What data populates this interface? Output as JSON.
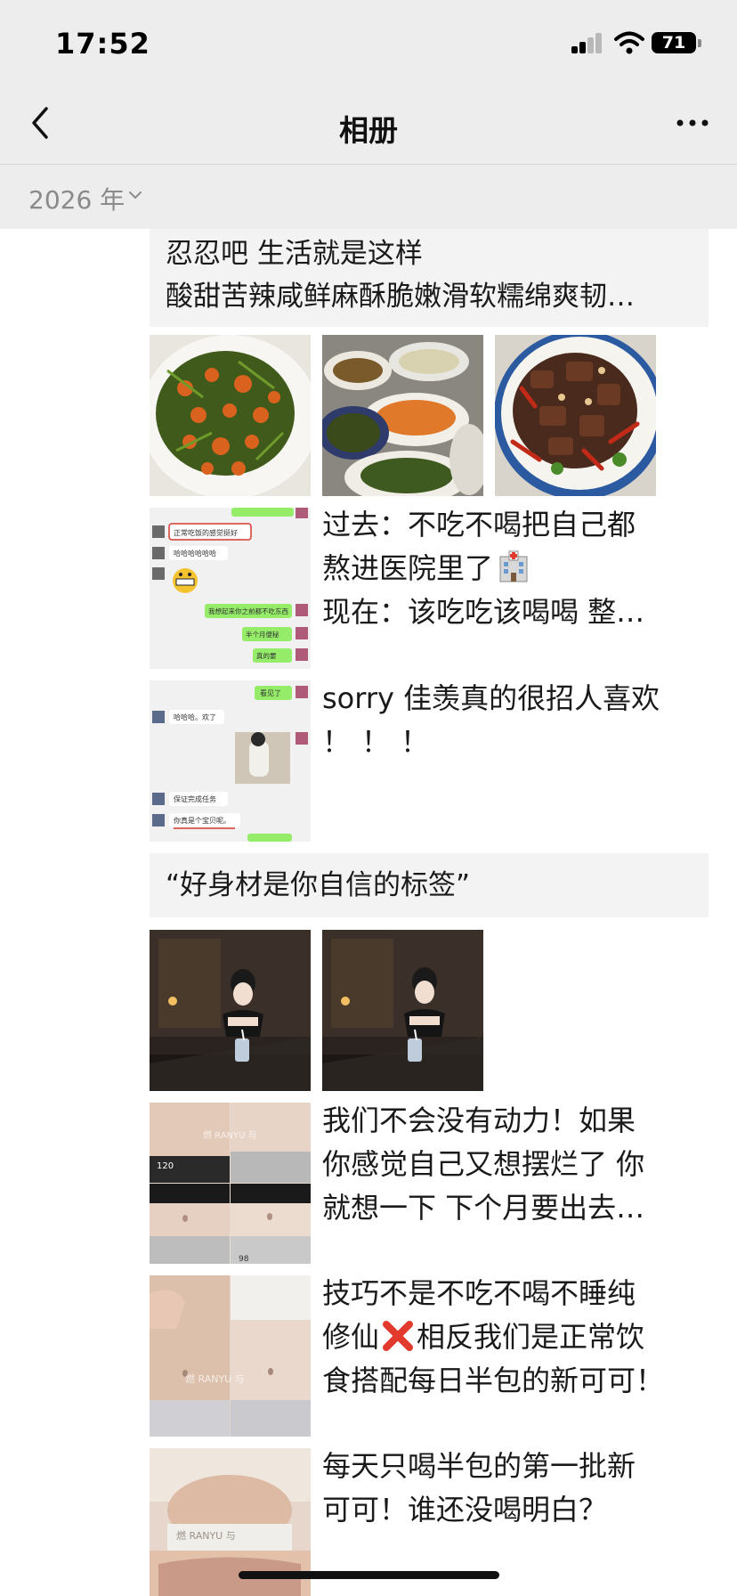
{
  "status": {
    "time": "17:52",
    "battery": "71"
  },
  "nav": {
    "title": "相册"
  },
  "year_filter": {
    "label": "2026 年"
  },
  "posts": [
    {
      "lines": [
        "忍忍吧 生活就是这样",
        "酸甜苦辣咸鲜麻酥脆嫩滑软糯绵爽韧…"
      ]
    },
    {
      "images": [
        "shrimp-stirfry-photo",
        "table-dishes-photo",
        "chili-beef-photo"
      ]
    },
    {
      "image": "chat-screenshot-1",
      "lines": [
        "过去：不吃不喝把自己都",
        "熬进医院里了",
        "现在：该吃吃该喝喝 整…"
      ],
      "emoji": "hospital-icon"
    },
    {
      "image": "chat-screenshot-2",
      "lines": [
        "sorry 佳羡真的很招人喜欢",
        "！！！"
      ]
    },
    {
      "lines": [
        "“好身材是你自信的标签”"
      ]
    },
    {
      "images": [
        "girl-cafe-photo-1",
        "girl-cafe-photo-2"
      ]
    },
    {
      "image": "waist-compare-photo-1",
      "lines": [
        "我们不会没有动力！如果",
        "你感觉自己又想摆烂了 你",
        "就想一下 下个月要出去…"
      ]
    },
    {
      "image": "waist-compare-photo-2",
      "lines": [
        "技巧不是不吃不喝不睡纯",
        "修仙",
        "相反我们是正常饮",
        "食搭配每日半包的新可可！"
      ]
    },
    {
      "image": "waist-compare-photo-3",
      "lines": [
        "每天只喝半包的第一批新",
        "可可！谁还没喝明白？"
      ]
    }
  ],
  "chat_text": {
    "c1": [
      "正常吃饭的感觉挺好",
      "哈哈哈哈哈哈",
      "我想起来你之前都不吃东西",
      "半个月便秘",
      "真的要"
    ],
    "c2": [
      "看见了",
      "哈哈哈。欢了",
      "保证完成任务",
      "你真是个宝贝呢。"
    ]
  },
  "photo_overlays": {
    "waist1_num": "120",
    "waist1_mark": "98",
    "brand": "燃 RANYU 与"
  },
  "colors": {
    "bg": "#ffffff",
    "bar": "#ededed",
    "card": "#f3f3f3",
    "wechat_green": "#95ec69",
    "red_cross": "#e23b2e"
  }
}
